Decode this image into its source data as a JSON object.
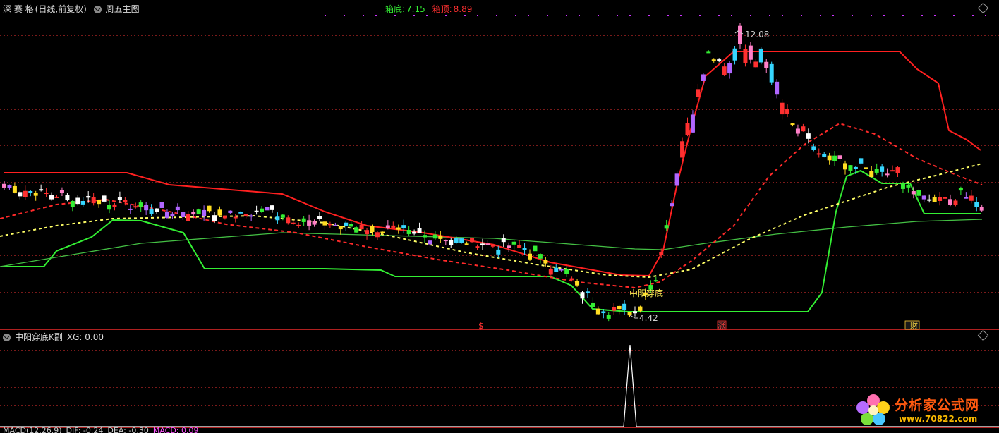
{
  "top_bar": {
    "stock_name": "深 赛 格",
    "period": "(日线,前复权)",
    "template_name": "周五主图",
    "box_bottom_label": "箱底:",
    "box_bottom_value": "7.15",
    "box_top_label": "箱顶:",
    "box_top_value": "8.89"
  },
  "main_chart": {
    "high_price_label": "12.08",
    "low_price_label": "4.42",
    "signal_text": "中阳穿底",
    "event_markers": [
      "$",
      "涨",
      "财"
    ]
  },
  "sub_panel": {
    "indicator_title": "中阳穿底K副",
    "indicator_value": "XG: 0.00"
  },
  "bottom_panel": {
    "macd_label": "MACD(12,26,9)",
    "dif": "DIF: -0.24",
    "dea": "DEA: -0.30",
    "macd_value": "MACD: 0.09"
  },
  "watermark": {
    "name": "分析家公式网",
    "url": "www.70822.com"
  },
  "colors": {
    "up": "#ff3030",
    "down": "#36d6ff",
    "green_line": "#33ee33",
    "yellow_dash": "#ffff66",
    "red_line": "#ff2020",
    "gridline": "#7a1a1a"
  },
  "chart_data": {
    "type": "candlestick",
    "price_range": [
      4.42,
      12.08
    ],
    "box_bottom": 7.15,
    "box_top": 8.89,
    "signal_index": 115,
    "xg_values": "0 except 1 at signal bar"
  }
}
